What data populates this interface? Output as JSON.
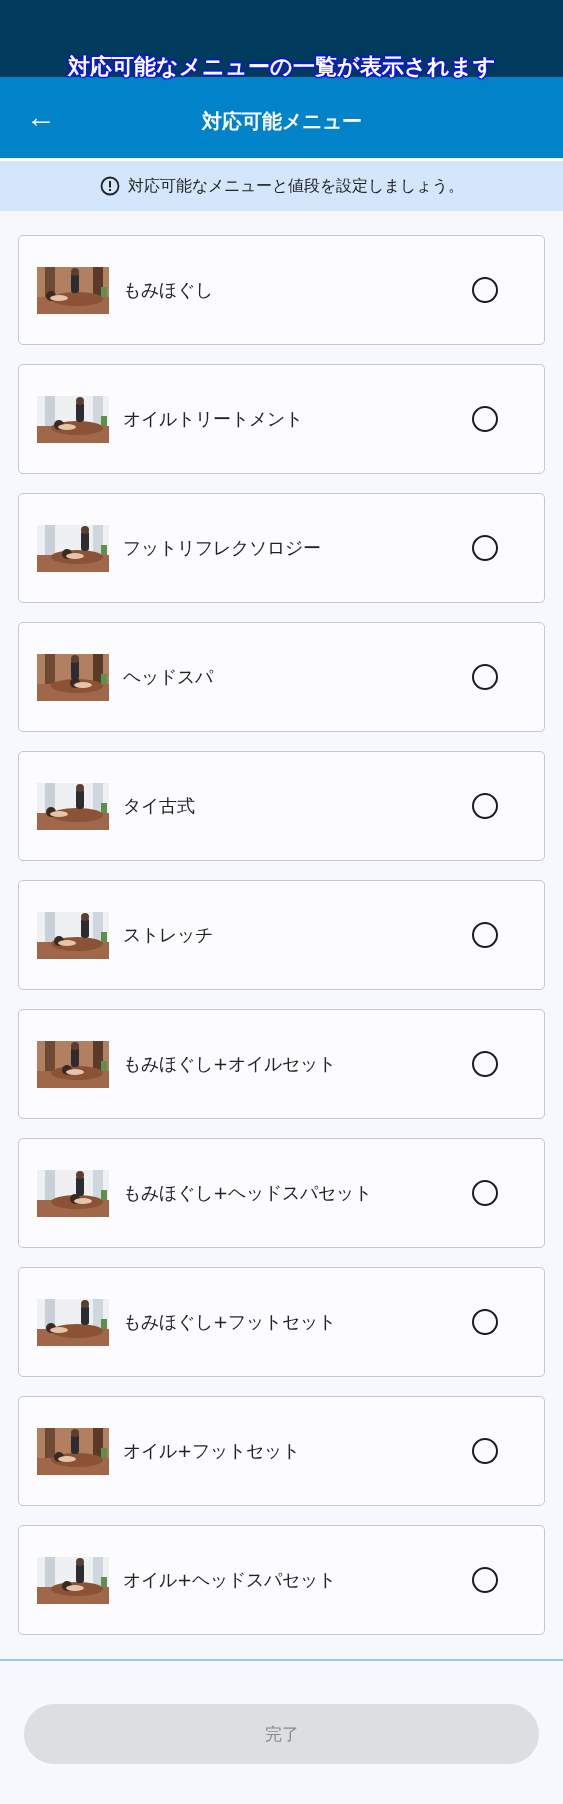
{
  "caption": "対応可能なメニューの一覧が表示されます",
  "header": {
    "back": "←",
    "title": "対応可能メニュー"
  },
  "notice": {
    "text": "対応可能なメニューと値段を設定しましょう。"
  },
  "menu_items": [
    {
      "label": "もみほぐし",
      "selected": false
    },
    {
      "label": "オイルトリートメント",
      "selected": false
    },
    {
      "label": "フットリフレクソロジー",
      "selected": false
    },
    {
      "label": "ヘッドスパ",
      "selected": false
    },
    {
      "label": "タイ古式",
      "selected": false
    },
    {
      "label": "ストレッチ",
      "selected": false
    },
    {
      "label": "もみほぐし+オイルセット",
      "selected": false
    },
    {
      "label": "もみほぐし+ヘッドスパセット",
      "selected": false
    },
    {
      "label": "もみほぐし+フットセット",
      "selected": false
    },
    {
      "label": "オイル+フットセット",
      "selected": false
    },
    {
      "label": "オイル+ヘッドスパセット",
      "selected": false
    }
  ],
  "done_button": {
    "label": "完了",
    "disabled": true
  }
}
